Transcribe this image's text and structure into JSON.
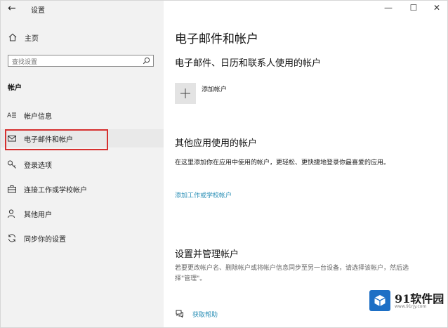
{
  "window": {
    "title": "设置",
    "controls": {
      "minimize": "—",
      "maximize": "☐",
      "close": "✕"
    }
  },
  "sidebar": {
    "home_label": "主页",
    "search_placeholder": "查找设置",
    "section_title": "帐户",
    "items": [
      {
        "label": "帐户信息",
        "icon": "account-info-icon"
      },
      {
        "label": "电子邮件和帐户",
        "icon": "mail-icon",
        "selected": true
      },
      {
        "label": "登录选项",
        "icon": "key-icon"
      },
      {
        "label": "连接工作或学校帐户",
        "icon": "briefcase-icon"
      },
      {
        "label": "其他用户",
        "icon": "person-icon"
      },
      {
        "label": "同步你的设置",
        "icon": "sync-icon"
      }
    ]
  },
  "main": {
    "page_title": "电子邮件和帐户",
    "section1": {
      "title": "电子邮件、日历和联系人使用的帐户",
      "add_label": "添加帐户"
    },
    "section2": {
      "title": "其他应用使用的帐户",
      "description": "在这里添加你在应用中使用的帐户，更轻松、更快捷地登录你最喜爱的应用。",
      "link": "添加工作或学校帐户"
    },
    "section3": {
      "title": "设置并管理帐户",
      "description": "若要更改帐户名、删除帐户或将帐户信息同步至另一台设备，请选择该帐户，然后选择\"管理\"。"
    },
    "help_label": "获取帮助"
  },
  "watermark": {
    "brand": "91软件园",
    "url": "www.91rjy.com"
  },
  "colors": {
    "selection_border": "#d6302f",
    "link": "#2a8fb6",
    "sidebar_bg": "#f2f2f2"
  }
}
